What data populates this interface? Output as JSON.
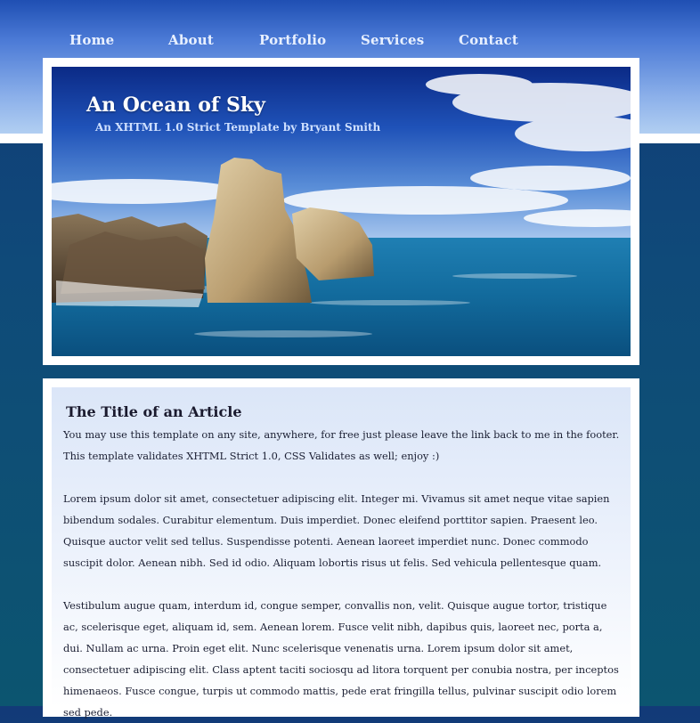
{
  "nav": {
    "items": [
      {
        "label": "Home"
      },
      {
        "label": "About"
      },
      {
        "label": "Portfolio"
      },
      {
        "label": "Services"
      },
      {
        "label": "Contact"
      }
    ]
  },
  "header": {
    "title": "An Ocean of Sky",
    "subtitle": "An XHTML 1.0 Strict Template by Bryant Smith"
  },
  "article": {
    "title": "The Title of an Article",
    "paragraphs": [
      "You may use this template on any site, anywhere, for free just please leave the link back to me in the footer. This template validates XHTML Strict 1.0, CSS Validates as well; enjoy :)",
      "Lorem ipsum dolor sit amet, consectetuer adipiscing elit. Integer mi. Vivamus sit amet neque vitae sapien bibendum sodales. Curabitur elementum. Duis imperdiet. Donec eleifend porttitor sapien. Praesent leo. Quisque auctor velit sed tellus. Suspendisse potenti. Aenean laoreet imperdiet nunc. Donec commodo suscipit dolor. Aenean nibh. Sed id odio. Aliquam lobortis risus ut felis. Sed vehicula pellentesque quam.",
      "Vestibulum augue quam, interdum id, congue semper, convallis non, velit. Quisque augue tortor, tristique ac, scelerisque eget, aliquam id, sem. Aenean lorem. Fusce velit nibh, dapibus quis, laoreet nec, porta a, dui. Nullam ac urna. Proin eget elit. Nunc scelerisque venenatis urna. Lorem ipsum dolor sit amet, consectetuer adipiscing elit. Class aptent taciti sociosqu ad litora torquent per conubia nostra, per inceptos himenaeos. Fusce congue, turpis ut commodo mattis, pede erat fringilla tellus, pulvinar suscipit odio lorem sed pede."
    ]
  },
  "colors": {
    "top_band": "#4b7ad6",
    "page_background": "#0f4a79",
    "content_panel": "#eef3fc",
    "text": "#1b1f33"
  }
}
